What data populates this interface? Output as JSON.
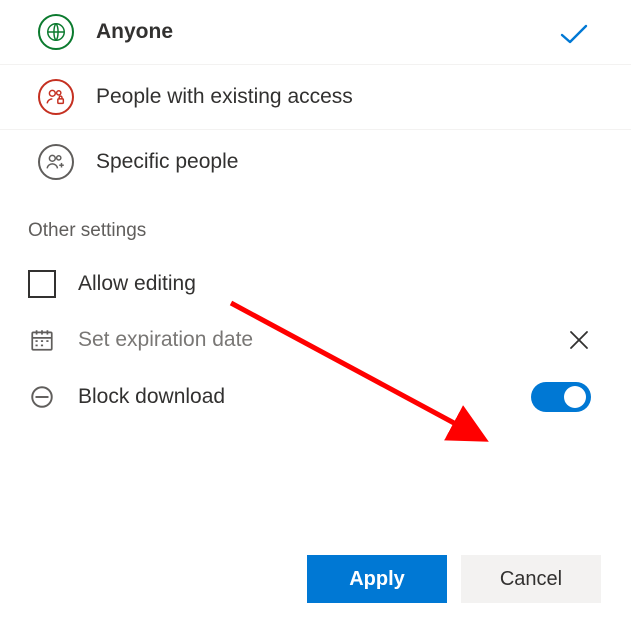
{
  "options": [
    {
      "label": "Anyone",
      "selected": true,
      "icon": "globe",
      "iconColor": "green",
      "bold": true
    },
    {
      "label": "People with existing access",
      "selected": false,
      "icon": "people-lock",
      "iconColor": "red",
      "bold": false
    },
    {
      "label": "Specific people",
      "selected": false,
      "icon": "people-plus",
      "iconColor": "gray",
      "bold": false
    }
  ],
  "settings": {
    "heading": "Other settings",
    "allow_editing": {
      "label": "Allow editing",
      "checked": false
    },
    "expiration": {
      "label": "Set expiration date"
    },
    "block_download": {
      "label": "Block download",
      "on": true
    }
  },
  "buttons": {
    "apply": "Apply",
    "cancel": "Cancel"
  },
  "colors": {
    "primary": "#0078d4",
    "green": "#0b7a2e",
    "red": "#c53021",
    "gray": "#605e5c",
    "arrow": "#ff0000"
  }
}
